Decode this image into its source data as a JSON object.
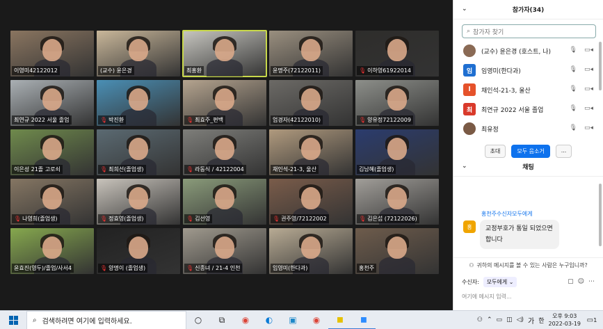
{
  "participants_panel": {
    "title": "참가자(34)",
    "search_placeholder": "참가자 찾기",
    "items": [
      {
        "name": "(교수) 윤은경 (호스트, 나)",
        "avatar": "",
        "color": "#8a6a55"
      },
      {
        "name": "임영미(한다과)",
        "avatar": "임",
        "color": "#1f6fd1"
      },
      {
        "name": "채인석-21-3, 울산",
        "avatar": "l",
        "color": "#e5522b"
      },
      {
        "name": "최연규 2022 서울 졸업",
        "avatar": "최",
        "color": "#d93a2b"
      },
      {
        "name": "최유정",
        "avatar": "",
        "color": "#7a5a45"
      }
    ],
    "buttons": [
      "초대",
      "모두 음소거",
      "..."
    ]
  },
  "chat": {
    "title": "채팅",
    "sender_line": "홍천주수신자모두에게",
    "avatar": "홍",
    "message": "교정부호가 통일 되었으면 합니다",
    "notice": "귀하의 메시지를 볼 수 있는 사람은 누구입니까?",
    "to_label": "수신자:",
    "to_value": "모두에게",
    "input_placeholder": "여기에 메시지 입력..."
  },
  "gallery": [
    {
      "name": "이영미42122012",
      "muted": false,
      "bg": "#8a7560"
    },
    {
      "name": "(교수) 윤은경",
      "muted": false,
      "bg": "#c9b79a"
    },
    {
      "name": "최홍환",
      "muted": false,
      "bg": "#c7c6c0",
      "active": true
    },
    {
      "name": "윤명주(72122011)",
      "muted": false,
      "bg": "#9a8f7f"
    },
    {
      "name": "이하영61922014",
      "muted": true,
      "bg": "#2e2d2b"
    },
    {
      "name": "최연규 2022 서울 졸업",
      "muted": false,
      "bg": "#aab0b4"
    },
    {
      "name": "박진환",
      "muted": true,
      "bg": "#4a8fb5"
    },
    {
      "name": "최효주_편백",
      "muted": true,
      "bg": "#b5a48f"
    },
    {
      "name": "엄경자(42122010)",
      "muted": false,
      "bg": "#6c6a66"
    },
    {
      "name": "양유정72122009",
      "muted": true,
      "bg": "#8d8f8a"
    },
    {
      "name": "이은성 21졸 고로쇠",
      "muted": false,
      "bg": "#6f8a4c"
    },
    {
      "name": "최희선(졸업생)",
      "muted": true,
      "bg": "#5b6a72"
    },
    {
      "name": "라동식 / 42122004",
      "muted": true,
      "bg": "#7e7e7a"
    },
    {
      "name": "채인석-21-3, 울산",
      "muted": false,
      "bg": "#b09a7e"
    },
    {
      "name": "김남혜(졸업생)",
      "muted": false,
      "bg": "#2b3c6e"
    },
    {
      "name": "나영희(졸업생)",
      "muted": true,
      "bg": "#857663"
    },
    {
      "name": "정효영(졸업생)",
      "muted": true,
      "bg": "#c8c3bb"
    },
    {
      "name": "김선영",
      "muted": true,
      "bg": "#8a9b7a"
    },
    {
      "name": "권주영/72122002",
      "muted": true,
      "bg": "#7a5c4a"
    },
    {
      "name": "김은섭 (72122026)",
      "muted": true,
      "bg": "#a19e99"
    },
    {
      "name": "윤효진(영두)/졸업/사서4",
      "muted": false,
      "bg": "#86a84e"
    },
    {
      "name": "양명이 (졸업생)",
      "muted": true,
      "bg": "#222222"
    },
    {
      "name": "신종녀 / 21-4 인천",
      "muted": true,
      "bg": "#a09a8e"
    },
    {
      "name": "임영미(한다과)",
      "muted": false,
      "bg": "#b8ab94"
    },
    {
      "name": "홍천주",
      "muted": false,
      "bg": "#6e5c4c"
    }
  ],
  "taskbar": {
    "search_placeholder": "검색하려면 여기에 입력하세요.",
    "ime": "가",
    "ime2": "한",
    "time": "오후 9:03",
    "date": "2022-03-19",
    "notif_count": "1"
  }
}
